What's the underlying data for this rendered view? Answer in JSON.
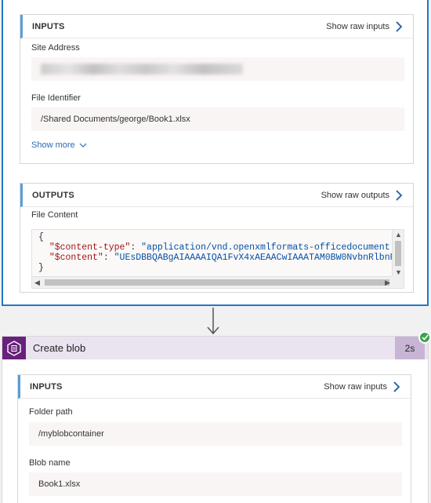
{
  "top_action": {
    "inputs": {
      "title": "INPUTS",
      "raw_link": "Show raw inputs",
      "site_address_label": "Site Address",
      "file_identifier_label": "File Identifier",
      "file_identifier_value": "/Shared Documents/george/Book1.xlsx",
      "show_more": "Show more"
    },
    "outputs": {
      "title": "OUTPUTS",
      "raw_link": "Show raw outputs",
      "file_content_label": "File Content",
      "code": {
        "open": "{",
        "line1_key": "\"$content-type\"",
        "line1_value": "\"application/vnd.openxmlformats-officedocument",
        "line2_key": "\"$content\"",
        "line2_value": "\"UEsDBBQABgAIAAAAIQA1FvX4xAEAACwIAAATAM0BW0NvbnRlbnR",
        "close": "}"
      }
    }
  },
  "create_blob": {
    "title": "Create blob",
    "duration": "2s",
    "status": "succeeded",
    "inputs": {
      "title": "INPUTS",
      "raw_link": "Show raw inputs",
      "folder_path_label": "Folder path",
      "folder_path_value": "/myblobcontainer",
      "blob_name_label": "Blob name",
      "blob_name_value": "Book1.xlsx"
    }
  },
  "colors": {
    "selected_border": "#1f78c8",
    "blob_brand": "#68217a",
    "blob_header_bg": "#ebe3f0",
    "duration_bg": "#c8b5d6",
    "success": "#3aa34f",
    "link": "#2b6cb0"
  },
  "icons": {
    "chevron_right": "chevron-right-icon",
    "chevron_down": "chevron-down-icon",
    "arrow_down": "arrow-down-icon",
    "blob_storage": "blob-storage-icon",
    "success": "checkmark-icon"
  }
}
